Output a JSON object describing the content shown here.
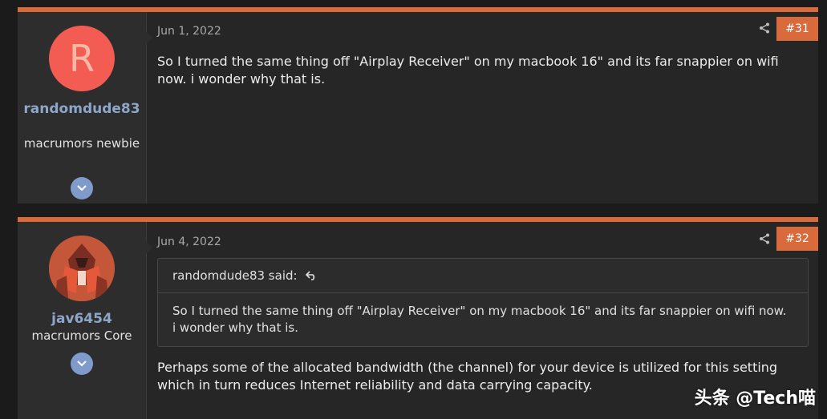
{
  "posts": [
    {
      "user": {
        "avatar_letter": "R",
        "username": "randomdude83",
        "title": "macrumors newbie"
      },
      "date": "Jun 1, 2022",
      "number": "#31",
      "body": "So I turned the same thing off \"Airplay Receiver\" on my macbook 16\" and its far snappier on wifi now. i wonder why that is."
    },
    {
      "user": {
        "username": "jav6454",
        "title": "macrumors Core"
      },
      "date": "Jun 4, 2022",
      "number": "#32",
      "quote": {
        "author_line": "randomdude83 said:",
        "text": "So I turned the same thing off \"Airplay Receiver\" on my macbook 16\" and its far snappier on wifi now. i wonder why that is."
      },
      "body": "Perhaps some of the allocated bandwidth (the channel) for your device is utilized for this setting which in turn reduces Internet reliability and data carrying capacity."
    }
  ],
  "watermark": "头条 @Tech喵",
  "colors": {
    "accent": "#d96a3b",
    "username": "#8ea6c9",
    "avatar_r": "#f25c52"
  },
  "icons": [
    "share-icon",
    "chevron-down-icon",
    "reply-arrow-icon"
  ]
}
